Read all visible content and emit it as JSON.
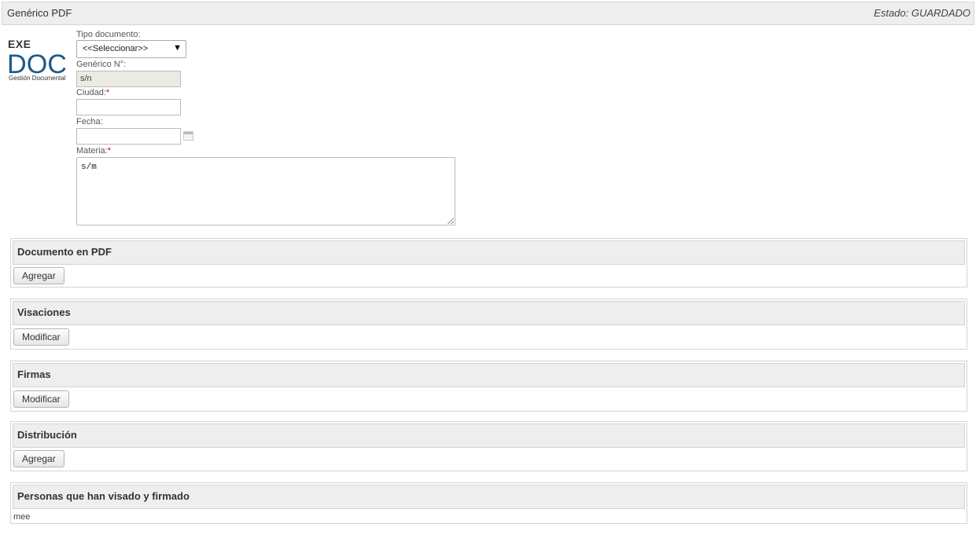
{
  "header": {
    "title": "Genérico PDF",
    "status": "Estado: GUARDADO"
  },
  "logo": {
    "brand": "EXE",
    "product": "DOC",
    "subtitle": "Gestión Documental",
    "color": "#1b5a8c"
  },
  "form": {
    "tipo_documento": {
      "label": "Tipo documento:",
      "value": "<<Seleccionar>>"
    },
    "generico_numero": {
      "label": "Genérico N°:",
      "value": "s/n"
    },
    "ciudad": {
      "label": "Ciudad:",
      "required_mark": "*",
      "value": ""
    },
    "fecha": {
      "label": "Fecha:",
      "value": ""
    },
    "materia": {
      "label": "Materia:",
      "required_mark": "*",
      "value": "s/m"
    }
  },
  "sections": {
    "documento_pdf": {
      "title": "Documento en PDF",
      "button": "Agregar"
    },
    "visaciones": {
      "title": "Visaciones",
      "button": "Modificar"
    },
    "firmas": {
      "title": "Firmas",
      "button": "Modificar"
    },
    "distribucion": {
      "title": "Distribución",
      "button": "Agregar"
    },
    "personas": {
      "title": "Personas que han visado y firmado",
      "content": "mee"
    }
  },
  "colors": {
    "header_bg": "#eeeeee",
    "border": "#d4d4d4",
    "required": "#cc0000"
  }
}
